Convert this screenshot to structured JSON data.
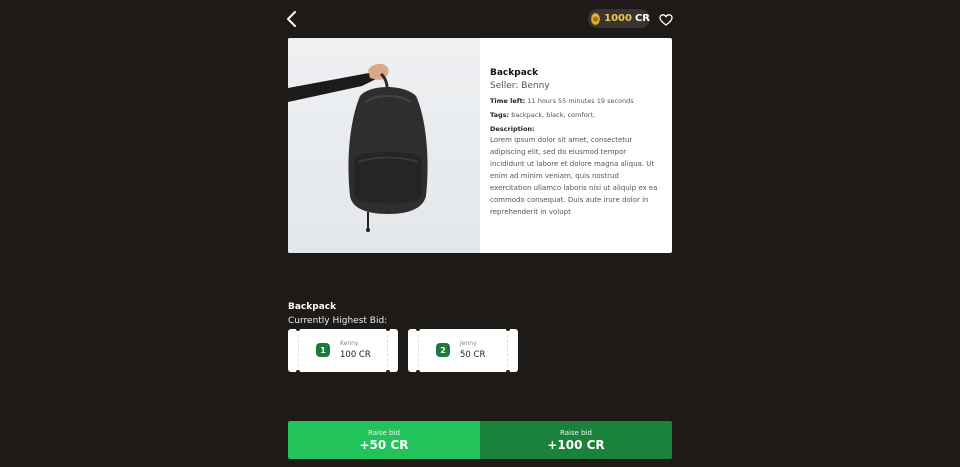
{
  "header": {
    "coins_amount": "1000",
    "coins_unit": "CR",
    "icons": {
      "back": "chevron-left-icon",
      "coin": "coin-icon",
      "favorite": "heart-icon"
    }
  },
  "item": {
    "title": "Backpack",
    "seller": "Seller: Benny",
    "time_left_label": "Time left:",
    "time_left_value": "11 hours 55 minutes 19 seconds",
    "tags_label": "Tags:",
    "tags_value": "backpack, black, comfort,",
    "description_label": "Description:",
    "description": "Lorem ipsum dolor sit amet, consectetur adipiscing elit, sed do eiusmod tempor incididunt ut labore et dolore magna aliqua. Ut enim ad minim veniam, quis nostrud exercitation ullamco laboris nisi ut aliquip ex ea commodo consequat. Duis aute irure dolor in reprehenderit in volupt"
  },
  "bids": {
    "title": "Backpack",
    "subtitle": "Currently Highest Bid:",
    "entries": [
      {
        "rank": "1",
        "name": "Kenny",
        "amount": "100 CR"
      },
      {
        "rank": "2",
        "name": "Jenny",
        "amount": "50 CR"
      }
    ]
  },
  "actions": {
    "raise_small": {
      "label": "Raise bid",
      "amount": "+50 CR",
      "color": "#22c35a"
    },
    "raise_large": {
      "label": "Raise bid",
      "amount": "+100 CR",
      "color": "#1b823b"
    }
  }
}
